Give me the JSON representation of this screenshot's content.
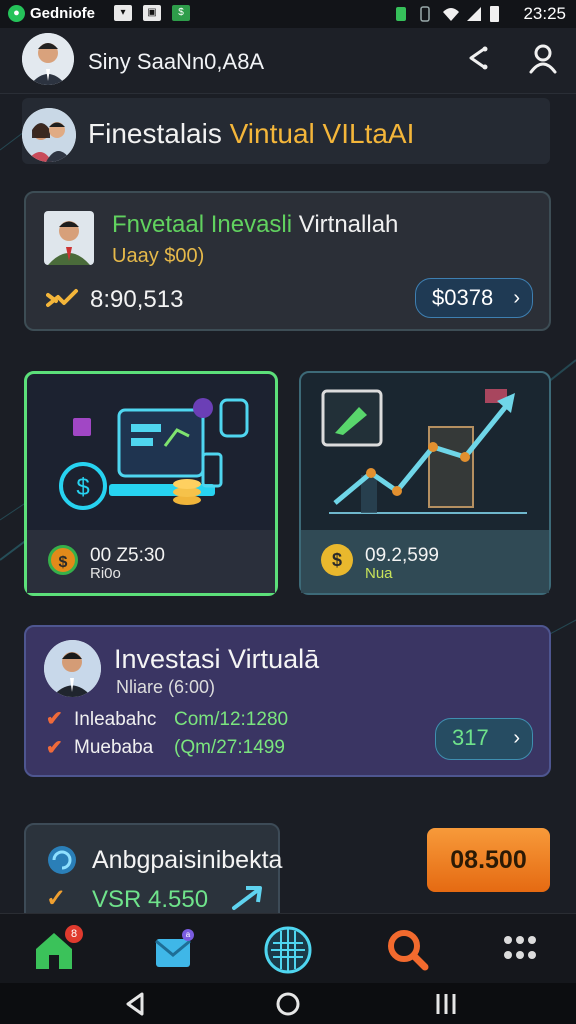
{
  "status_bar": {
    "carrier": "Gedniofe",
    "time": "23:25"
  },
  "header": {
    "user_name": "Siny SaaNn0,A8A",
    "share_icon": "share-icon",
    "profile_icon": "user-icon"
  },
  "banner": {
    "title_white": "Finestalais",
    "title_yellow": "Vintual VILtaAI"
  },
  "featured_card": {
    "title_green": "Fnvetaal Inevasli",
    "title_white": "Virtnallah",
    "subtitle": "Uaay $00)",
    "amount": "8:90,513",
    "button_label": "$0378"
  },
  "tiles": [
    {
      "number": "00 Z5:30",
      "label": "Ri0o"
    },
    {
      "number": "09.2,599",
      "label": "Nua"
    }
  ],
  "investment_card": {
    "title": "Investasi Virtualā",
    "subtitle": "Nliare (6:00)",
    "rows": [
      {
        "label": "Inleabahc",
        "value": "Com/12:1280"
      },
      {
        "label": "Muebaba",
        "value": "(Qm/27:1499"
      }
    ],
    "button_label": "317"
  },
  "bottom_card": {
    "title": "Anbgpaisinibekta",
    "value": "VSR 4.550"
  },
  "orange_button": {
    "label": "08.500"
  },
  "nav": {
    "home_badge": "8",
    "mail_badge": "a"
  },
  "colors": {
    "accent_green": "#5ce07a",
    "accent_orange": "#f08a2a",
    "gold": "#f4b63a",
    "card_purple": "#3a3563"
  }
}
